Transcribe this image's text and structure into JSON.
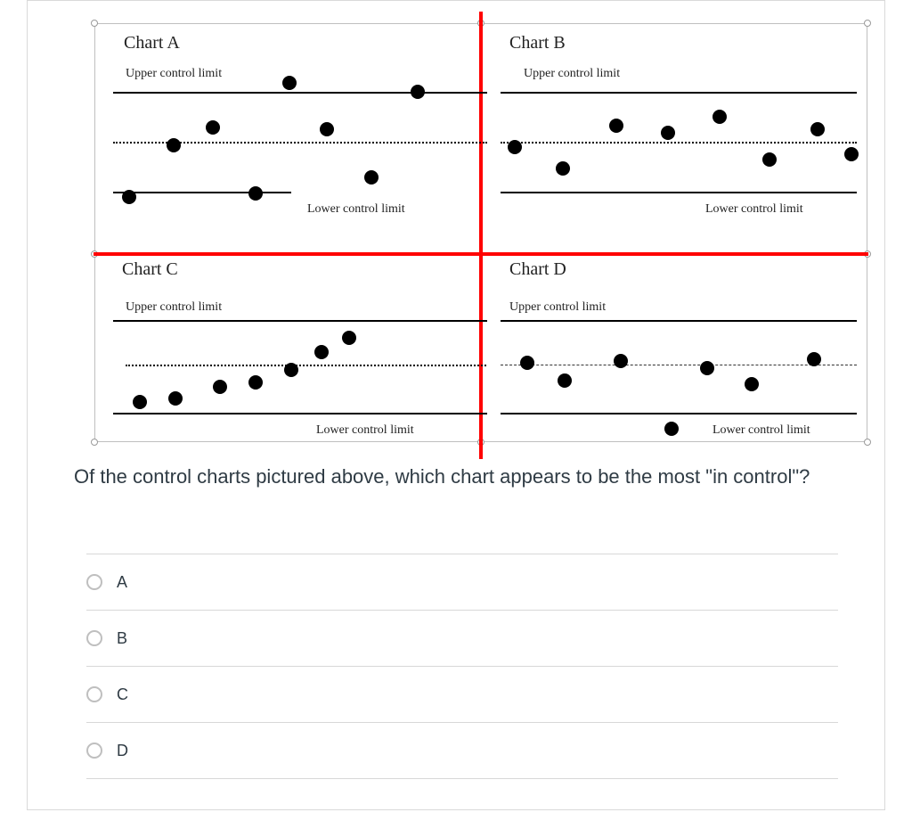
{
  "question": "Of the control charts pictured above, which chart appears to be the most \"in control\"?",
  "options": [
    {
      "label": "A"
    },
    {
      "label": "B"
    },
    {
      "label": "C"
    },
    {
      "label": "D"
    }
  ],
  "charts": {
    "A": {
      "title": "Chart A",
      "ucl_label": "Upper control limit",
      "lcl_label": "Lower control limit"
    },
    "B": {
      "title": "Chart B",
      "ucl_label": "Upper control limit",
      "lcl_label": "Lower control limit"
    },
    "C": {
      "title": "Chart C",
      "ucl_label": "Upper control limit",
      "lcl_label": "Lower control limit"
    },
    "D": {
      "title": "Chart D",
      "ucl_label": "Upper control limit",
      "lcl_label": "Lower control limit"
    }
  },
  "chart_data": [
    {
      "name": "Chart A",
      "type": "scatter",
      "xlabel": "",
      "ylabel": "",
      "ucl": 1,
      "center": 0,
      "lcl": -1,
      "ylim": [
        -1.2,
        1.6
      ],
      "points": [
        {
          "x": 1,
          "y": -1.0
        },
        {
          "x": 2,
          "y": 0.05
        },
        {
          "x": 3,
          "y": 0.4
        },
        {
          "x": 4,
          "y": -1.0
        },
        {
          "x": 5,
          "y": 1.4
        },
        {
          "x": 6,
          "y": 0.3
        },
        {
          "x": 7,
          "y": -0.8
        },
        {
          "x": 8,
          "y": 1.2
        }
      ]
    },
    {
      "name": "Chart B",
      "type": "scatter",
      "xlabel": "",
      "ylabel": "",
      "ucl": 1,
      "center": 0,
      "lcl": -1,
      "ylim": [
        -1.2,
        1.2
      ],
      "points": [
        {
          "x": 1,
          "y": -0.15
        },
        {
          "x": 2,
          "y": -0.6
        },
        {
          "x": 3,
          "y": 0.3
        },
        {
          "x": 4,
          "y": 0.15
        },
        {
          "x": 5,
          "y": 0.45
        },
        {
          "x": 6,
          "y": -0.4
        },
        {
          "x": 7,
          "y": 0.2
        },
        {
          "x": 8,
          "y": -0.3
        }
      ]
    },
    {
      "name": "Chart C",
      "type": "scatter",
      "xlabel": "",
      "ylabel": "",
      "ucl": 1,
      "center": 0,
      "lcl": -1,
      "ylim": [
        -1.2,
        1.2
      ],
      "points": [
        {
          "x": 1,
          "y": -0.75
        },
        {
          "x": 2,
          "y": -0.65
        },
        {
          "x": 3,
          "y": -0.45
        },
        {
          "x": 4,
          "y": -0.35
        },
        {
          "x": 5,
          "y": -0.1
        },
        {
          "x": 6,
          "y": 0.25
        },
        {
          "x": 7,
          "y": 0.55
        }
      ]
    },
    {
      "name": "Chart D",
      "type": "scatter",
      "xlabel": "",
      "ylabel": "",
      "ucl": 1,
      "center": 0,
      "lcl": -1,
      "ylim": [
        -1.4,
        1.2
      ],
      "points": [
        {
          "x": 1,
          "y": 0.1
        },
        {
          "x": 2,
          "y": -0.25
        },
        {
          "x": 3,
          "y": 0.1
        },
        {
          "x": 4,
          "y": -1.35
        },
        {
          "x": 5,
          "y": -0.05
        },
        {
          "x": 6,
          "y": -0.35
        },
        {
          "x": 7,
          "y": 0.15
        }
      ]
    }
  ]
}
